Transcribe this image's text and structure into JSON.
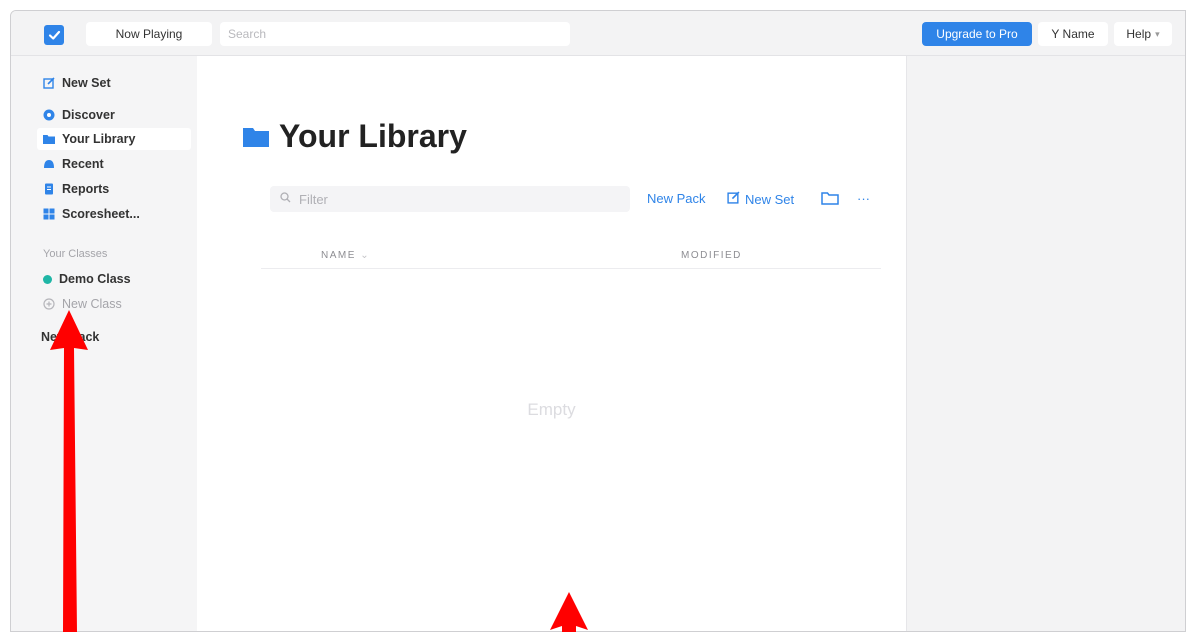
{
  "topbar": {
    "now_playing": "Now Playing",
    "search_placeholder": "Search",
    "upgrade": "Upgrade to Pro",
    "username": "Y Name",
    "help": "Help"
  },
  "sidebar": {
    "new_set": "New Set",
    "items": [
      {
        "label": "Discover",
        "icon": "discover-icon"
      },
      {
        "label": "Your Library",
        "icon": "folder-icon",
        "active": true
      },
      {
        "label": "Recent",
        "icon": "recent-icon"
      },
      {
        "label": "Reports",
        "icon": "reports-icon"
      },
      {
        "label": "Scoresheet...",
        "icon": "scoresheet-icon"
      }
    ],
    "classes_label": "Your Classes",
    "classes": [
      {
        "label": "Demo Class",
        "color": "#1fb6a6"
      },
      {
        "label": "New Class",
        "color": "#b5b5ba"
      }
    ],
    "new_pack": "New Pack"
  },
  "main": {
    "title": "Your Library",
    "filter_placeholder": "Filter",
    "new_pack": "New Pack",
    "new_set": "New Set",
    "more": "···",
    "col_name": "NAME",
    "col_modified": "MODIFIED",
    "empty": "Empty"
  },
  "colors": {
    "accent": "#2f84e8",
    "arrow": "#ff0000"
  }
}
